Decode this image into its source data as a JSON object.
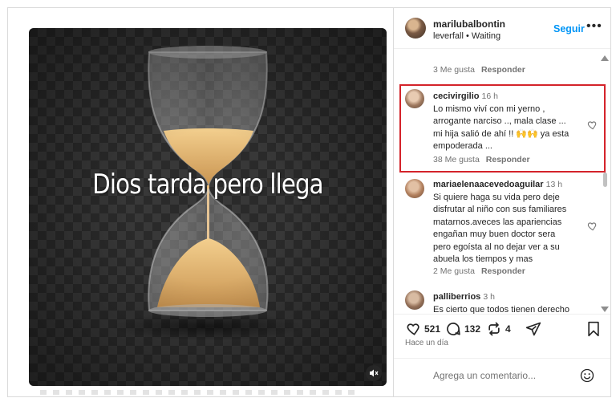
{
  "post": {
    "overlay_text": "Dios tarda pero llega",
    "author": "marilubalbontin",
    "audio": "leverfall • Waiting",
    "follow_label": "Seguir",
    "more_label": "•••"
  },
  "comments": {
    "previous_meta": {
      "likes": "3 Me gusta",
      "reply": "Responder"
    },
    "items": [
      {
        "username": "cecivirgilio",
        "time": "16 h",
        "text": "Lo mismo viví con mi yerno , arrogante narciso .., mala clase ... mi hija salió de ahí !! 🙌🙌 ya esta empoderada ...",
        "likes": "38 Me gusta",
        "reply": "Responder",
        "highlighted": true
      },
      {
        "username": "mariaelenaacevedoaguilar",
        "time": "13 h",
        "text": "Si quiere haga su vida pero deje disfrutar al niño con sus familiares matarnos.aveces las apariencias engañan muy buen doctor sera pero egoísta al no dejar ver a su abuela los tiempos y mas",
        "likes": "2 Me gusta",
        "reply": "Responder"
      },
      {
        "username": "palliberrios",
        "time": "3 h",
        "text": "Es cierto que todos tienen derecho"
      }
    ]
  },
  "actions": {
    "likes_count": "521",
    "comments_count": "132",
    "reposts_count": "4",
    "posted_ago": "Hace un día"
  },
  "composer": {
    "placeholder": "Agrega un comentario..."
  },
  "colors": {
    "accent": "#0095f6",
    "highlight_border": "#d4232a",
    "muted_text": "#737373"
  },
  "icons": [
    "heart-icon",
    "comment-icon",
    "repost-icon",
    "share-icon",
    "bookmark-icon",
    "emoji-icon",
    "mute-icon",
    "more-icon"
  ]
}
